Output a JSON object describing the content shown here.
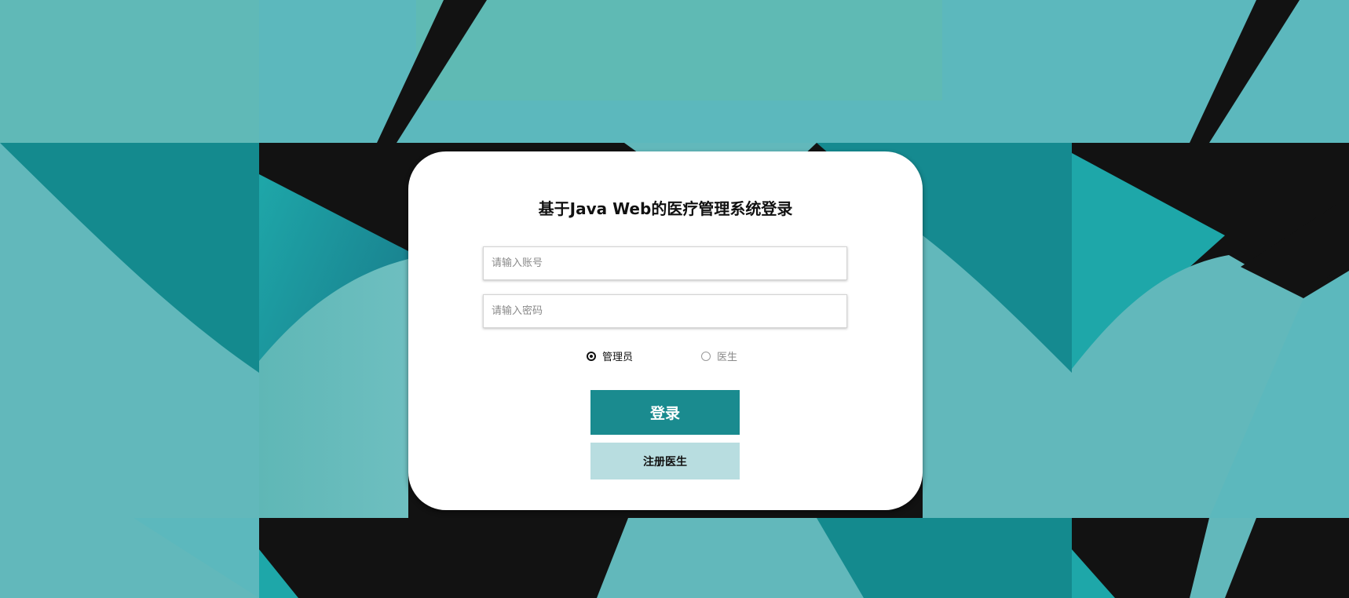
{
  "login": {
    "title": "基于Java Web的医疗管理系统登录",
    "account_placeholder": "请输入账号",
    "password_placeholder": "请输入密码",
    "roles": [
      {
        "label": "管理员",
        "selected": true
      },
      {
        "label": "医生",
        "selected": false
      }
    ],
    "login_button": "登录",
    "register_button": "注册医生"
  },
  "colors": {
    "background_teal": "#5cb8bd",
    "dark_teal": "#1a8b8f",
    "black_band": "#121212",
    "register_button_bg": "#b8dde0"
  }
}
